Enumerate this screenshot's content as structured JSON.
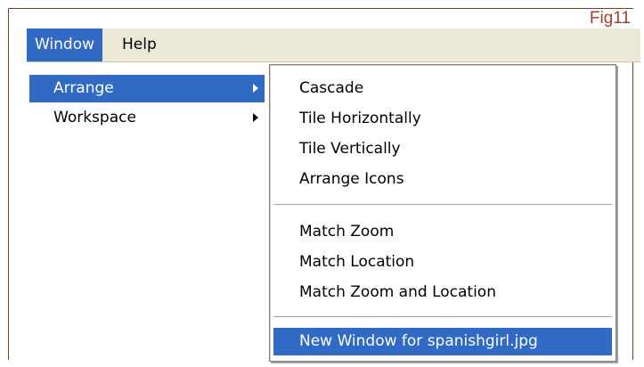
{
  "figure": {
    "label": "Fig11"
  },
  "menubar": {
    "items": [
      {
        "label": "Window",
        "active": true
      },
      {
        "label": "Help",
        "active": false
      }
    ]
  },
  "window_menu": {
    "items": [
      {
        "label": "Arrange",
        "has_submenu": true,
        "highlighted": true
      },
      {
        "label": "Workspace",
        "has_submenu": true,
        "highlighted": false
      }
    ]
  },
  "arrange_submenu": {
    "group1": [
      "Cascade",
      "Tile Horizontally",
      "Tile Vertically",
      "Arrange Icons"
    ],
    "group2": [
      "Match Zoom",
      "Match Location",
      "Match Zoom and Location"
    ],
    "group3": [
      "New Window for spanishgirl.jpg"
    ],
    "highlighted_item": "New Window for spanishgirl.jpg"
  },
  "colors": {
    "highlight": "#316ac5",
    "menubar_bg": "#ece9d8",
    "frame_border": "#8a3a2a",
    "fig_label": "#a4402a"
  }
}
